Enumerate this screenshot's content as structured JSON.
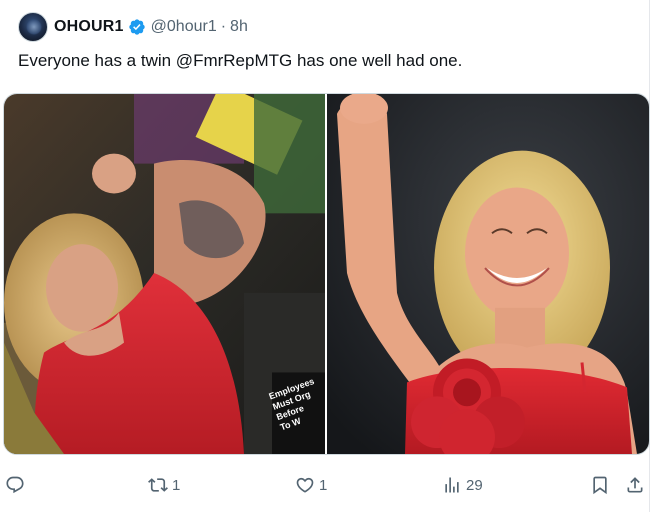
{
  "tweet": {
    "display_name": "OHOUR1",
    "handle": "@0hour1",
    "separator": "·",
    "time": "8h",
    "text": "Everyone has a twin @FmrRepMTG has one well had one.",
    "verified": true
  },
  "media": {
    "left_image": {
      "sign_text_lines": [
        "Employees",
        "Must Org",
        "Before",
        "To W"
      ]
    },
    "right_image": {}
  },
  "actions": {
    "reply": {
      "icon": "reply-icon",
      "count": ""
    },
    "repost": {
      "icon": "repost-icon",
      "count": "1"
    },
    "like": {
      "icon": "heart-icon",
      "count": "1"
    },
    "views": {
      "icon": "views-icon",
      "count": "29"
    },
    "bookmark": {
      "icon": "bookmark-icon"
    },
    "share": {
      "icon": "share-icon"
    }
  },
  "colors": {
    "text": "#0f1419",
    "secondary": "#536471",
    "verified": "#1d9bf0",
    "dress_red": "#d4222a"
  }
}
